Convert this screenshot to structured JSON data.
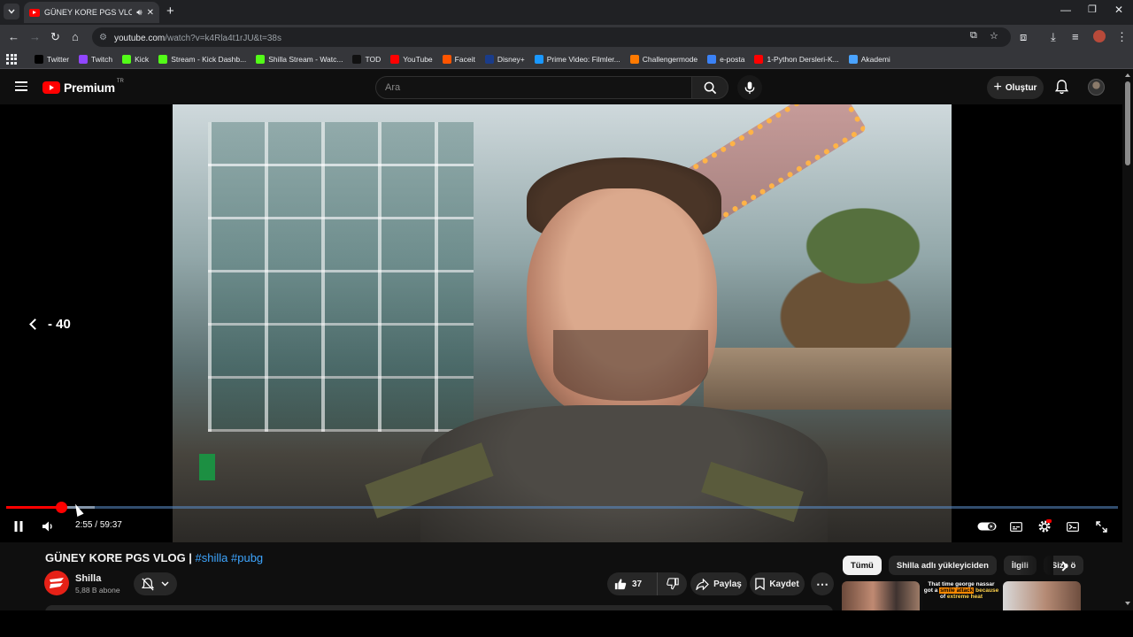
{
  "browser": {
    "tab_title": "GÜNEY KORE PGS VLOG | #",
    "url_prefix": "youtube.com",
    "url_path": "/watch?v=k4Rla4t1rJU&t=38s",
    "bookmarks": [
      {
        "label": "Twitter",
        "icon": "x-icon",
        "color": "#000000"
      },
      {
        "label": "Twitch",
        "icon": "twitch-icon",
        "color": "#9146ff"
      },
      {
        "label": "Kick",
        "icon": "kick-icon",
        "color": "#53fc18"
      },
      {
        "label": "Stream - Kick Dashb...",
        "icon": "kick-icon",
        "color": "#53fc18"
      },
      {
        "label": "Shilla Stream - Watc...",
        "icon": "kick-icon",
        "color": "#53fc18"
      },
      {
        "label": "TOD",
        "icon": "tod-icon",
        "color": "#111111"
      },
      {
        "label": "YouTube",
        "icon": "youtube-icon",
        "color": "#ff0000"
      },
      {
        "label": "Faceit",
        "icon": "faceit-icon",
        "color": "#ff5500"
      },
      {
        "label": "Disney+",
        "icon": "disney-icon",
        "color": "#1a3c8a"
      },
      {
        "label": "Prime Video: Filmler...",
        "icon": "prime-icon",
        "color": "#1a98ff"
      },
      {
        "label": "Challengermode",
        "icon": "challengermode-icon",
        "color": "#ff7a00"
      },
      {
        "label": "e-posta",
        "icon": "mail-icon",
        "color": "#3b82f6"
      },
      {
        "label": "1-Python Dersleri-K...",
        "icon": "youtube-icon",
        "color": "#ff0000"
      },
      {
        "label": "Akademi",
        "icon": "akademi-icon",
        "color": "#4aa3ff"
      }
    ]
  },
  "header": {
    "logo_text": "Premium",
    "country_code": "TR",
    "search_placeholder": "Ara",
    "create_label": "Oluştur"
  },
  "player": {
    "seek_indicator": "- 40",
    "current_time": "2:55",
    "duration": "59:37",
    "progress_fraction": 0.049,
    "buffered_fraction": 0.08,
    "accent_color": "#ff0000"
  },
  "video": {
    "title_main": "GÜNEY KORE PGS VLOG | ",
    "hashtags": "#shilla #pubg",
    "channel_name": "Shilla",
    "subscribers": "5,88 B abone",
    "like_count": "37",
    "share_label": "Paylaş",
    "save_label": "Kaydet"
  },
  "sidebar": {
    "chips": [
      "Tümü",
      "Shilla adlı yükleyiciden",
      "İlgili",
      "Size ö"
    ],
    "thumb2_lines": [
      "That time george nassar",
      "got a",
      "smile attack",
      "because",
      "of",
      "extreme heat"
    ]
  }
}
